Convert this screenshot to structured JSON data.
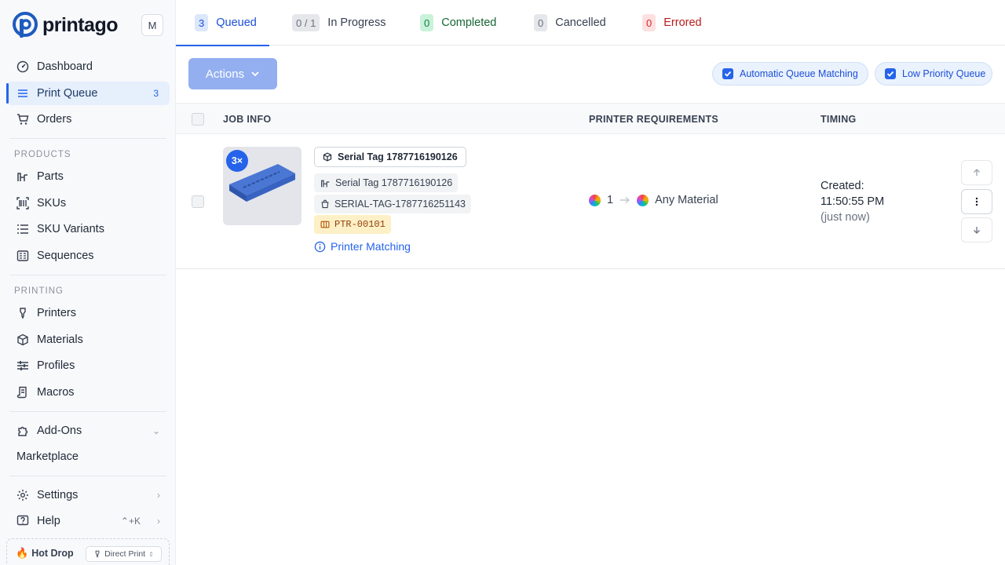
{
  "app": {
    "brand": "printago",
    "avatar_initial": "M"
  },
  "sidebar": {
    "items": [
      {
        "label": "Dashboard"
      },
      {
        "label": "Print Queue",
        "count": "3"
      },
      {
        "label": "Orders"
      }
    ],
    "products_label": "PRODUCTS",
    "products": [
      {
        "label": "Parts"
      },
      {
        "label": "SKUs"
      },
      {
        "label": "SKU Variants"
      },
      {
        "label": "Sequences"
      }
    ],
    "printing_label": "PRINTING",
    "printing": [
      {
        "label": "Printers"
      },
      {
        "label": "Materials"
      },
      {
        "label": "Profiles"
      },
      {
        "label": "Macros"
      }
    ],
    "addons": "Add-Ons",
    "marketplace": "Marketplace",
    "settings": "Settings",
    "help": "Help",
    "help_shortcut": "⌃+K",
    "hot_drop": "Hot Drop",
    "direct_print": "Direct Print"
  },
  "tabs": [
    {
      "count": "3",
      "label": "Queued"
    },
    {
      "count": "0 / 1",
      "label": "In Progress"
    },
    {
      "count": "0",
      "label": "Completed"
    },
    {
      "count": "0",
      "label": "Cancelled"
    },
    {
      "count": "0",
      "label": "Errored"
    }
  ],
  "toolbar": {
    "actions_label": "Actions",
    "auto_match_label": "Automatic Queue Matching",
    "auto_match_checked": true,
    "low_priority_label": "Low Priority Queue",
    "low_priority_checked": true
  },
  "table": {
    "headers": {
      "job_info": "JOB INFO",
      "printer_requirements": "PRINTER REQUIREMENTS",
      "timing": "TIMING"
    },
    "rows": [
      {
        "quantity": "3×",
        "title": "Serial Tag 1787716190126",
        "part_name": "Serial Tag 1787716190126",
        "sku": "SERIAL-TAG-1787716251143",
        "code": "PTR-00101",
        "printer_matching": "Printer Matching",
        "printer_count": "1",
        "material": "Any Material",
        "created_label": "Created:",
        "created_time": "11:50:55 PM",
        "created_relative": "(just now)"
      }
    ]
  },
  "colors": {
    "accent": "#2563eb",
    "completed": "#15803d",
    "errored": "#b91c1c"
  }
}
